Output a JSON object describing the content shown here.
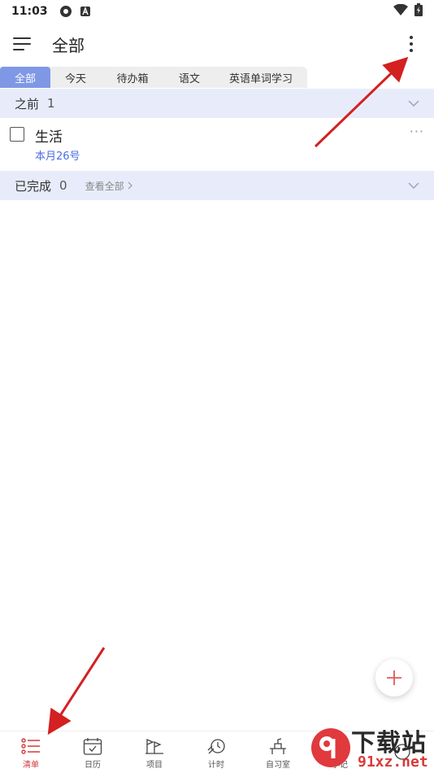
{
  "status_bar": {
    "time": "11:03"
  },
  "header": {
    "title": "全部"
  },
  "tabs": [
    {
      "label": "全部"
    },
    {
      "label": "今天"
    },
    {
      "label": "待办箱"
    },
    {
      "label": "语文"
    },
    {
      "label": "英语单词学习"
    }
  ],
  "groups": {
    "before": {
      "label": "之前",
      "count": "1"
    },
    "done": {
      "label": "已完成",
      "count": "0",
      "view_all": "查看全部"
    }
  },
  "task": {
    "title": "生活",
    "date": "本月26号"
  },
  "bottom_nav": [
    {
      "label": "清单",
      "icon": "list-icon"
    },
    {
      "label": "日历",
      "icon": "calendar-icon"
    },
    {
      "label": "项目",
      "icon": "project-icon"
    },
    {
      "label": "计时",
      "icon": "timer-icon"
    },
    {
      "label": "自习室",
      "icon": "study-room-icon"
    },
    {
      "label": "小记",
      "icon": "notes-icon"
    }
  ],
  "watermark": {
    "text": "下载站",
    "url": "91xz.net"
  },
  "colors": {
    "accent": "#7e98e6",
    "active_nav": "#d03a3a",
    "group_bg": "#e8ecfa",
    "date_blue": "#4a6ee0",
    "arrow": "#d42020"
  }
}
